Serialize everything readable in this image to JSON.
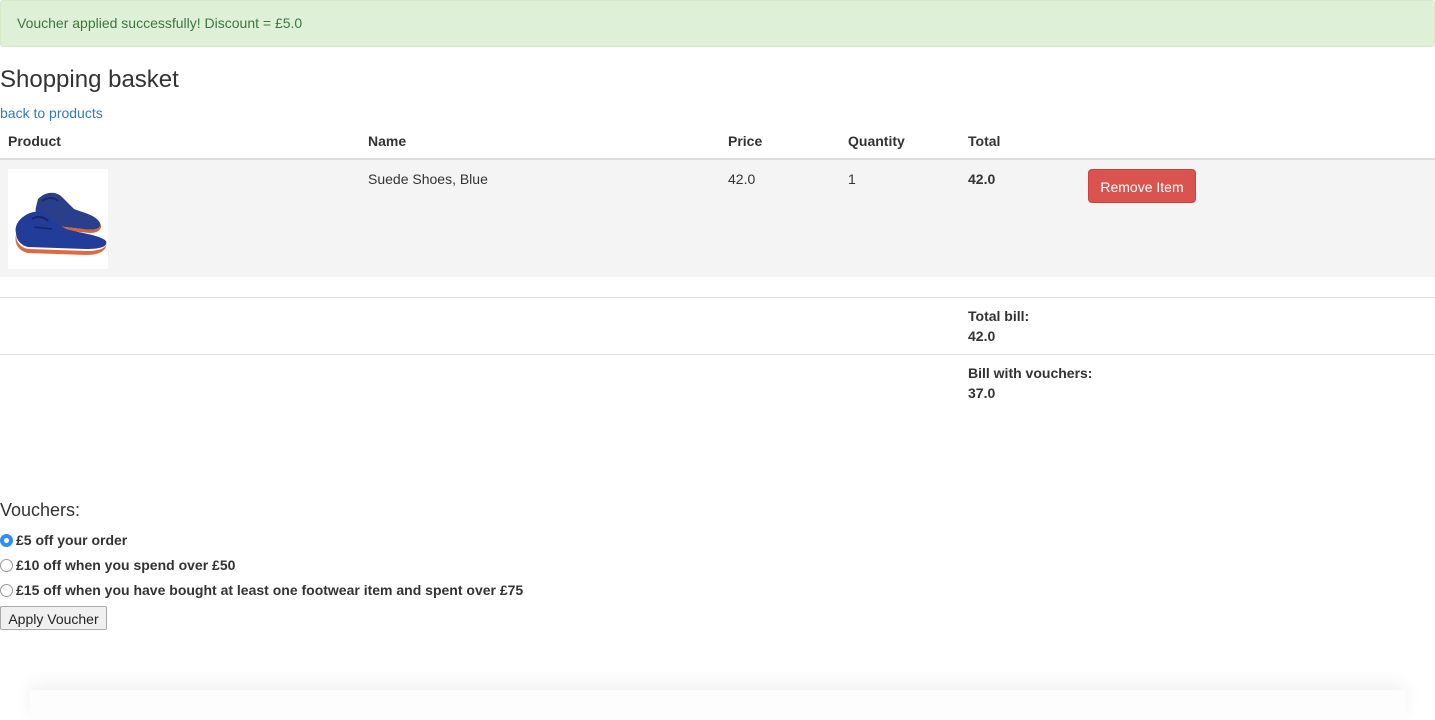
{
  "alert": {
    "message": "Voucher applied successfully! Discount = £5.0"
  },
  "page": {
    "title": "Shopping basket",
    "back_link": "back to products"
  },
  "table": {
    "headers": {
      "product": "Product",
      "name": "Name",
      "price": "Price",
      "quantity": "Quantity",
      "total": "Total"
    },
    "rows": [
      {
        "name": "Suede Shoes, Blue",
        "price": "42.0",
        "quantity": "1",
        "total": "42.0",
        "remove_label": "Remove Item",
        "image": "blue-suede-shoes-icon"
      }
    ]
  },
  "summary": {
    "total_bill_label": "Total bill:",
    "total_bill_value": "42.0",
    "bill_with_vouchers_label": "Bill with vouchers:",
    "bill_with_vouchers_value": "37.0"
  },
  "vouchers": {
    "title": "Vouchers:",
    "options": [
      {
        "label": "£5 off your order",
        "checked": true
      },
      {
        "label": "£10 off when you spend over £50",
        "checked": false
      },
      {
        "label": "£15 off when you have bought at least one footwear item and spent over £75",
        "checked": false
      }
    ],
    "apply_label": "Apply Voucher"
  },
  "colors": {
    "alert_bg": "#dff0d8",
    "alert_text": "#3c763d",
    "link": "#337ab7",
    "danger": "#d9534f",
    "row_bg": "#f4f4f4",
    "radio_checked": "#2f8ef2"
  }
}
